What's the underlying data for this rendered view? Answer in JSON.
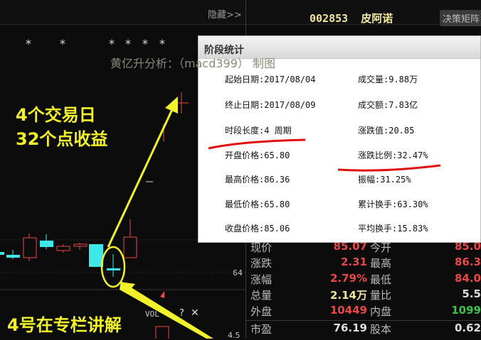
{
  "topbar": {
    "hide_label": "隐藏>>",
    "stock_code": "002853",
    "stock_name": "皮阿诺",
    "decision_button": "决策矩阵"
  },
  "chart": {
    "stars": [
      "*",
      "*",
      "*",
      "*",
      "*",
      "*"
    ],
    "watermark": "黄亿升分析：（macd399） 制图",
    "annotation_top_line1": "4个交易日",
    "annotation_top_line2": "32个点收益",
    "annotation_bottom": "4号在专栏讲解",
    "y_label_64": "64",
    "y_label_45": "4.5",
    "vol_label": "VOL",
    "vol_help": "?",
    "vol_close": "✕"
  },
  "dialog": {
    "title": "阶段统计",
    "rows": [
      {
        "left": "起始日期:2017/08/04",
        "right": "成交量:9.88万"
      },
      {
        "left": "终止日期:2017/08/09",
        "right": "成交额:7.83亿"
      },
      {
        "left": "时段长度:4 周期",
        "right": "涨跌值:20.85"
      },
      {
        "left": "开盘价格:65.80",
        "right": "涨跌比例:32.47%"
      },
      {
        "left": "最高价格:86.36",
        "right": "振幅:31.25%"
      },
      {
        "left": "最低价格:65.80",
        "right": "累计换手:63.30%"
      },
      {
        "left": "收盘价格:85.06",
        "right": "平均换手:15.83%"
      }
    ]
  },
  "quote": [
    {
      "l1": "现价",
      "v1": "85.07",
      "l2": "今开",
      "v2": "85.0"
    },
    {
      "l1": "涨跌",
      "v1": "2.31",
      "l2": "最高",
      "v2": "86.3"
    },
    {
      "l1": "涨幅",
      "v1": "2.79%",
      "l2": "最低",
      "v2": "84.0"
    },
    {
      "l1": "总量",
      "v1": "2.14万",
      "l2": "量比",
      "v2": "5.5"
    },
    {
      "l1": "外盘",
      "v1": "10449",
      "l2": "内盘",
      "v2": "1099"
    },
    {
      "l1": "市盈",
      "v1": "76.19",
      "l2": "股本",
      "v2": "0.62"
    }
  ],
  "colors": {
    "up": "#e84848",
    "down": "#3ee8e8",
    "annotation": "#f2f22a",
    "underline": "#e01010"
  }
}
